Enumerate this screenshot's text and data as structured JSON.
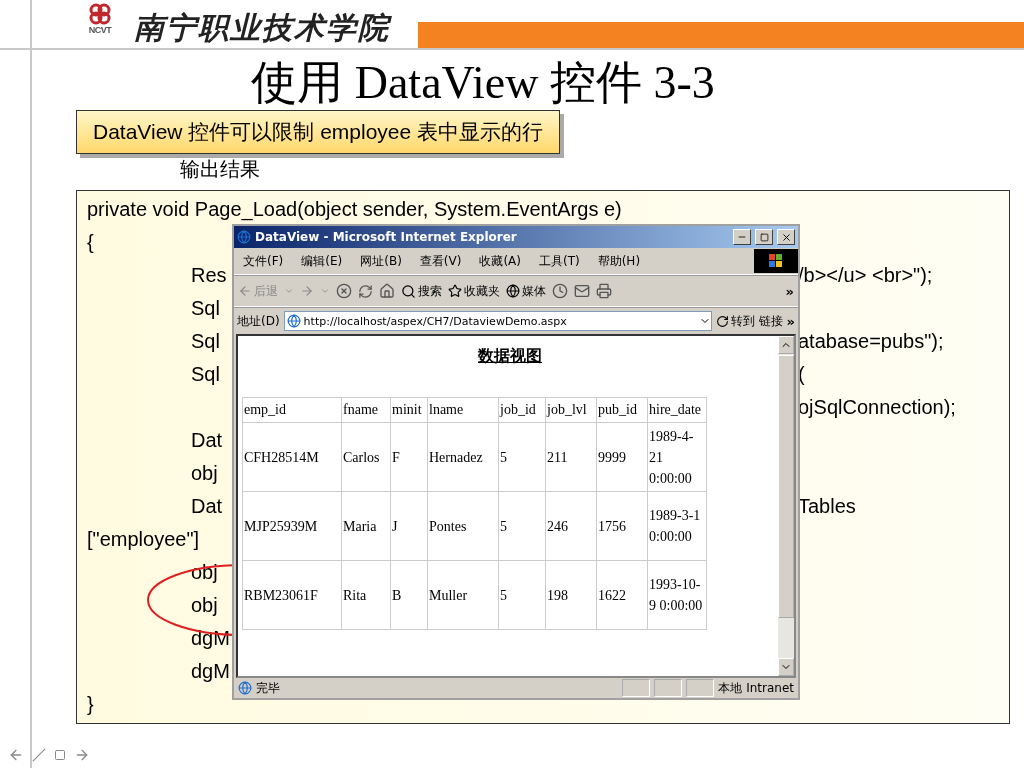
{
  "header": {
    "logo_text": "NCVT",
    "school": "南宁职业技术学院"
  },
  "title": "使用 DataView 控件 3-3",
  "callout": "DataView 控件可以限制 employee 表中显示的行",
  "output_label": "输出结果",
  "code": [
    {
      "kind": "plain",
      "text": "private void Page_Load(object sender, System.EventArgs e)"
    },
    {
      "kind": "plain",
      "text": "{"
    },
    {
      "kind": "split",
      "left": "Res",
      "right": "/b></u> <br>\");"
    },
    {
      "kind": "split",
      "left": "Sql"
    },
    {
      "kind": "split",
      "left": "Sql",
      "right": "atabase=pubs\");"
    },
    {
      "kind": "split",
      "left": "Sql",
      "right": "("
    },
    {
      "kind": "split",
      "right": "ojSqlConnection);"
    },
    {
      "kind": "split",
      "left": "Dat"
    },
    {
      "kind": "split",
      "left": "obj"
    },
    {
      "kind": "split",
      "left": "Dat",
      "right": "Tables"
    },
    {
      "kind": "plain",
      "text": "[\"employee\"]"
    },
    {
      "kind": "split",
      "left": "obj"
    },
    {
      "kind": "split",
      "left": "obj"
    },
    {
      "kind": "split",
      "left": "dgM"
    },
    {
      "kind": "split",
      "left": "dgM"
    },
    {
      "kind": "plain",
      "text": "}"
    }
  ],
  "browser": {
    "title": "DataView - Microsoft Internet Explorer",
    "menu": [
      "文件(F)",
      "编辑(E)",
      "网址(B)",
      "查看(V)",
      "收藏(A)",
      "工具(T)",
      "帮助(H)"
    ],
    "toolbar": {
      "back": "后退",
      "search": "搜索",
      "favorites": "收藏夹",
      "media": "媒体",
      "more": "»"
    },
    "address": {
      "label": "地址(D)",
      "url": "http://localhost/aspex/CH7/DataviewDemo.aspx",
      "go": "转到",
      "links": "链接",
      "more": "»"
    },
    "page": {
      "heading": "数据视图",
      "table": {
        "columns": [
          "emp_id",
          "fname",
          "minit",
          "lname",
          "job_id",
          "job_lvl",
          "pub_id",
          "hire_date"
        ],
        "rows": [
          [
            "CFH28514M",
            "Carlos",
            "F",
            "Hernadez",
            "5",
            "211",
            "9999",
            "1989-4-21 0:00:00"
          ],
          [
            "MJP25939M",
            "Maria",
            "J",
            "Pontes",
            "5",
            "246",
            "1756",
            "1989-3-1 0:00:00"
          ],
          [
            "RBM23061F",
            "Rita",
            "B",
            "Muller",
            "5",
            "198",
            "1622",
            "1993-10-9 0:00:00"
          ]
        ]
      }
    },
    "status": {
      "text": "完毕",
      "zone": "本地 Intranet"
    }
  }
}
